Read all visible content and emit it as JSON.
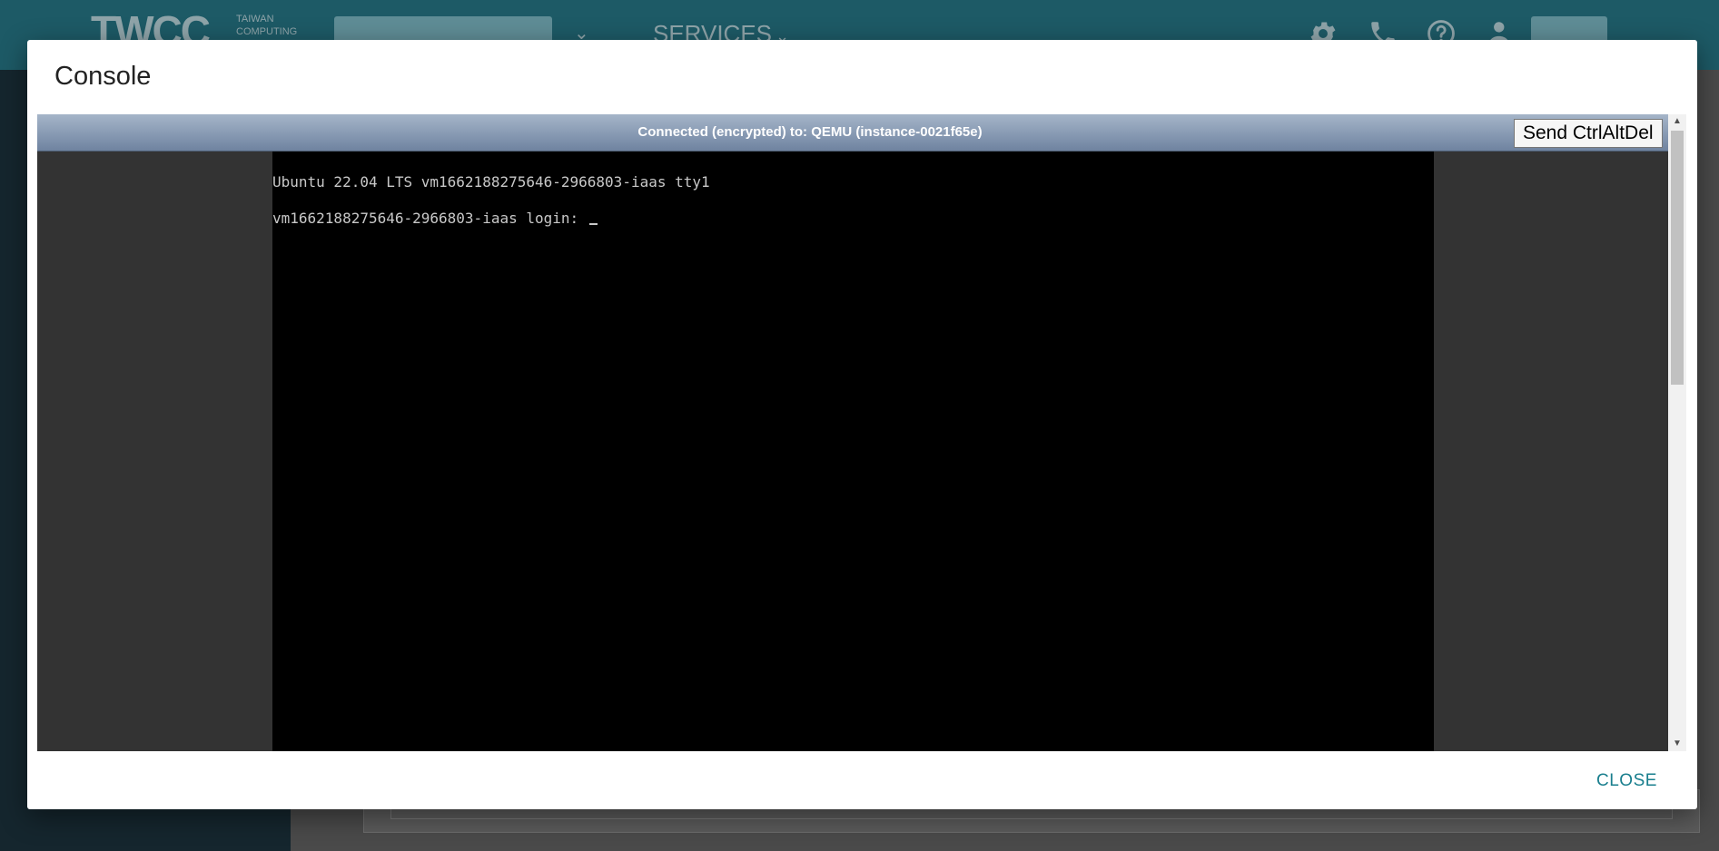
{
  "background_app": {
    "logo_mark": "TWCC",
    "logo_sub": "TAIWAN COMPUTING",
    "services_label": "SERVICES"
  },
  "dialog": {
    "title": "Console",
    "close_label": "CLOSE"
  },
  "console": {
    "status": "Connected (encrypted) to: QEMU (instance-0021f65e)",
    "ctrl_alt_del_label": "Send CtrlAltDel",
    "lines": [
      "Ubuntu 22.04 LTS vm1662188275646-2966803-iaas tty1",
      "vm1662188275646-2966803-iaas login: "
    ]
  },
  "colors": {
    "accent": "#1a7f8e",
    "header": "#1d5a66",
    "status_bar_top": "#a5b5c9",
    "status_bar_bottom": "#6f83a0"
  },
  "icons": {
    "header": [
      "gear-icon",
      "phone-icon",
      "help-icon",
      "user-icon"
    ]
  }
}
